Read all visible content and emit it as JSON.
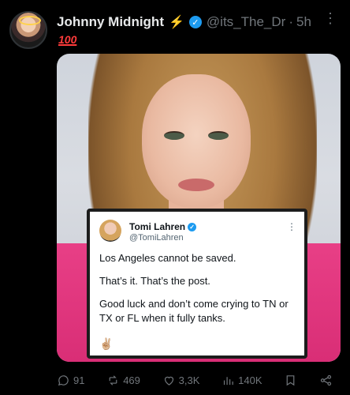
{
  "post": {
    "author_name": "Johnny Midnight",
    "handle": "@its_The_Dr",
    "separator": "·",
    "time": "5h",
    "badge_text": "100",
    "icons": {
      "bolt": "lightning-bolt-icon",
      "verified": "verified-badge-icon",
      "more": "more-options-icon"
    }
  },
  "quote": {
    "name": "Tomi Lahren",
    "handle": "@TomiLahren",
    "lines": [
      "Los Angeles cannot be saved.",
      "That’s it. That’s the post.",
      "Good luck and don’t come crying to TN or TX or FL when it fully tanks."
    ],
    "emoji": "✌🏼"
  },
  "actions": {
    "replies": "91",
    "reposts": "469",
    "likes": "3,3K",
    "views": "140K"
  },
  "colors": {
    "accent": "#1d9bf0",
    "muted": "#71767b",
    "background": "#000000"
  }
}
